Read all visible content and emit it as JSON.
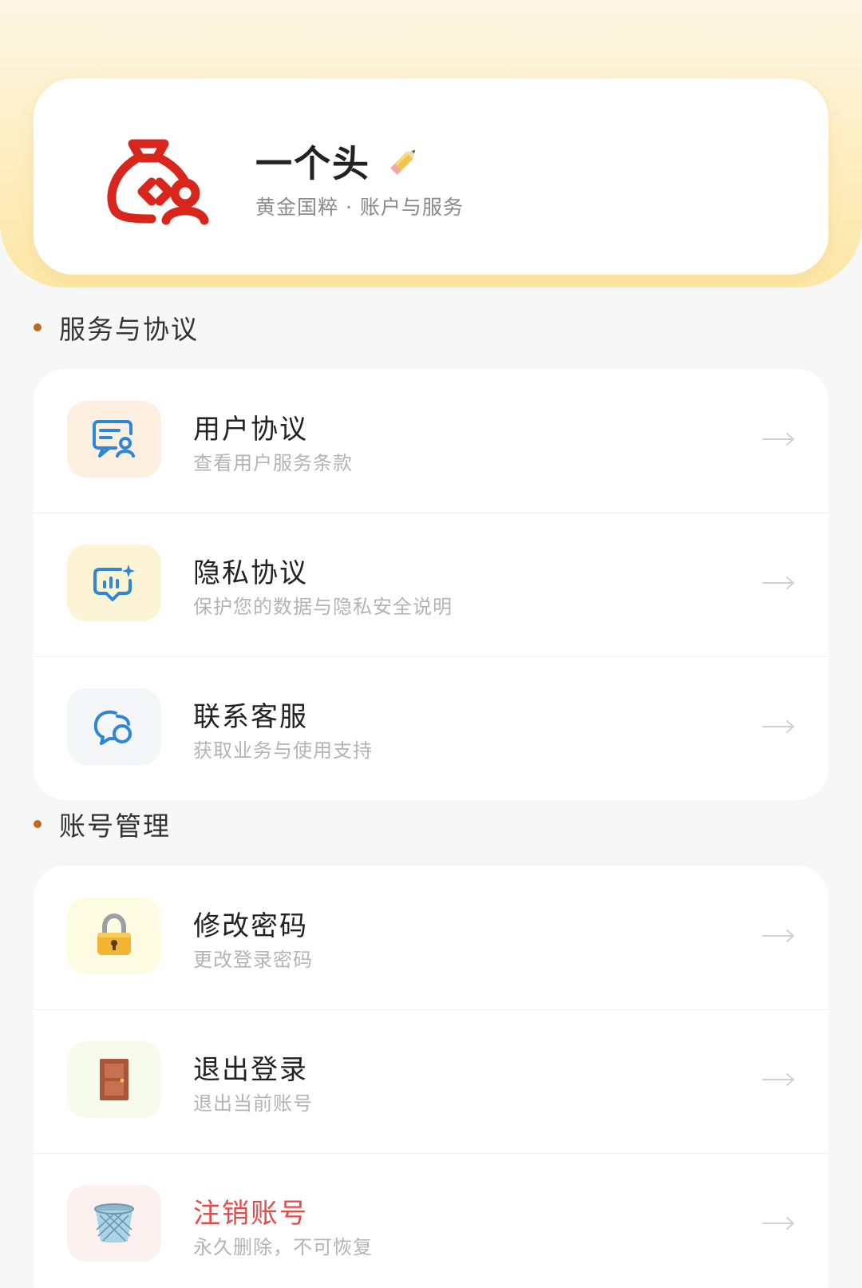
{
  "profile": {
    "name": "一个头",
    "subtitle": "黄金国粹 · 账户与服务",
    "logo_icon": "money-bag-user-icon",
    "brand_color": "#d8261c"
  },
  "sections": [
    {
      "title": "服务与协议",
      "items": [
        {
          "title": "用户协议",
          "subtitle": "查看用户服务条款",
          "icon": "user-agreement-icon",
          "icon_bg": "#fdf0e0"
        },
        {
          "title": "隐私协议",
          "subtitle": "保护您的数据与隐私安全说明",
          "icon": "privacy-chart-icon",
          "icon_bg": "#fdf4d6"
        },
        {
          "title": "联系客服",
          "subtitle": "获取业务与使用支持",
          "icon": "chat-bubble-icon",
          "icon_bg": "#f4f6f8"
        }
      ]
    },
    {
      "title": "账号管理",
      "items": [
        {
          "title": "修改密码",
          "subtitle": "更改登录密码",
          "icon": "lock-icon",
          "icon_bg": "#fefbe3"
        },
        {
          "title": "退出登录",
          "subtitle": "退出当前账号",
          "icon": "door-icon",
          "icon_bg": "#f7fbec"
        },
        {
          "title": "注销账号",
          "subtitle": "永久删除，不可恢复",
          "icon": "trash-bin-icon",
          "icon_bg": "#fdf1f0",
          "danger": true
        }
      ]
    }
  ],
  "colors": {
    "accent_dot": "#c26a1c",
    "icon_blue": "#2d86d6",
    "danger": "#e24b4b"
  }
}
